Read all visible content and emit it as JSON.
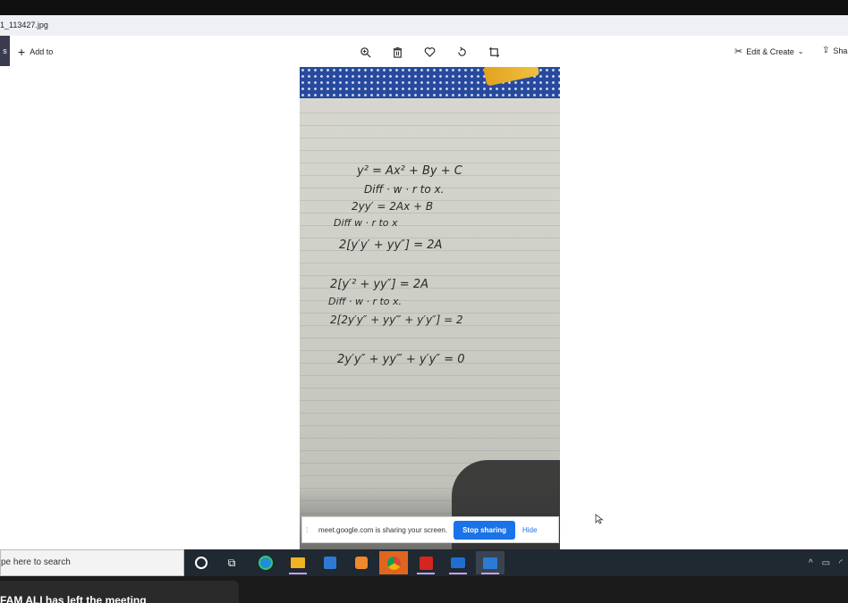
{
  "window": {
    "title": "1_113427.jpg"
  },
  "toolbar": {
    "nav_stub": "s",
    "add_to_label": "Add to",
    "edit_create_label": "Edit & Create",
    "share_label": "Sha"
  },
  "photo": {
    "math_lines": [
      "y² = Ax² + By + C",
      "Diff · w · r to x.",
      "2yy′ = 2Ax + B",
      "Diff  w · r to x",
      "2[y′y′ + yy″] = 2A",
      "2[y′² + yy″] = 2A",
      "Diff · w · r to x.",
      "2[2y′y″ + yy‴ + y′y″] = 2",
      "2y′y″ + yy‴ + y′y″ = 0"
    ]
  },
  "share_banner": {
    "message": "meet.google.com is sharing your screen.",
    "stop_label": "Stop sharing",
    "hide_label": "Hide"
  },
  "taskbar": {
    "search_placeholder": "pe here to search",
    "accent_colors": {
      "chrome_bg": "#e0661f",
      "acrobat": "#d4251f",
      "edge": "#1f8fd8",
      "files": "#f0b323",
      "store": "#2d7ad4",
      "media": "#ef8a2a",
      "zoom": "#1f6fd0",
      "photos": "#2a7ad6"
    }
  },
  "notification": {
    "text": "FAM ALI has left the meeting"
  }
}
